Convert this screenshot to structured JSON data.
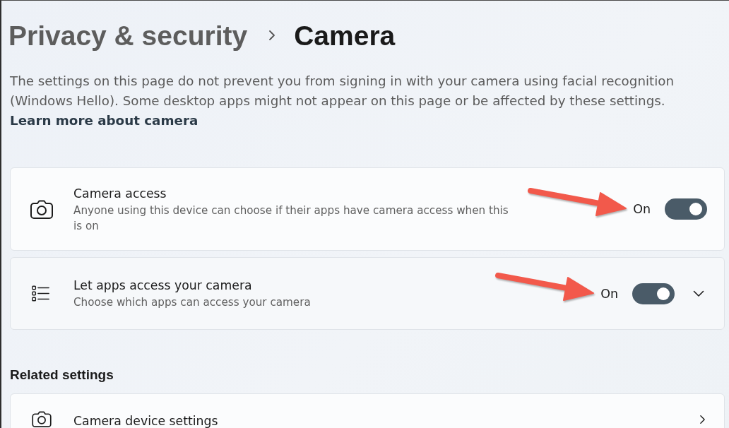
{
  "breadcrumb": [
    {
      "label": "Privacy & security",
      "current": false
    },
    {
      "label": "Camera",
      "current": true
    }
  ],
  "description": "The settings on this page do not prevent you from signing in with your camera using facial recognition (Windows Hello). Some desktop apps might not appear on this page or be affected by these settings.",
  "learn_more_link": "Learn more about camera",
  "settings": [
    {
      "kind": "toggle",
      "title": "Camera access",
      "subtitle": "Anyone using this device can choose if their apps have camera access when this is on",
      "state_label": "On",
      "on": true,
      "annotated": true
    },
    {
      "kind": "expandable",
      "title": "Let apps access your camera",
      "subtitle": "Choose which apps can access your camera",
      "state_label": "On",
      "on": true,
      "expanded": false,
      "annotated": true
    }
  ],
  "related_settings": {
    "heading": "Related settings",
    "items": [
      {
        "title": "Camera device settings"
      }
    ]
  }
}
